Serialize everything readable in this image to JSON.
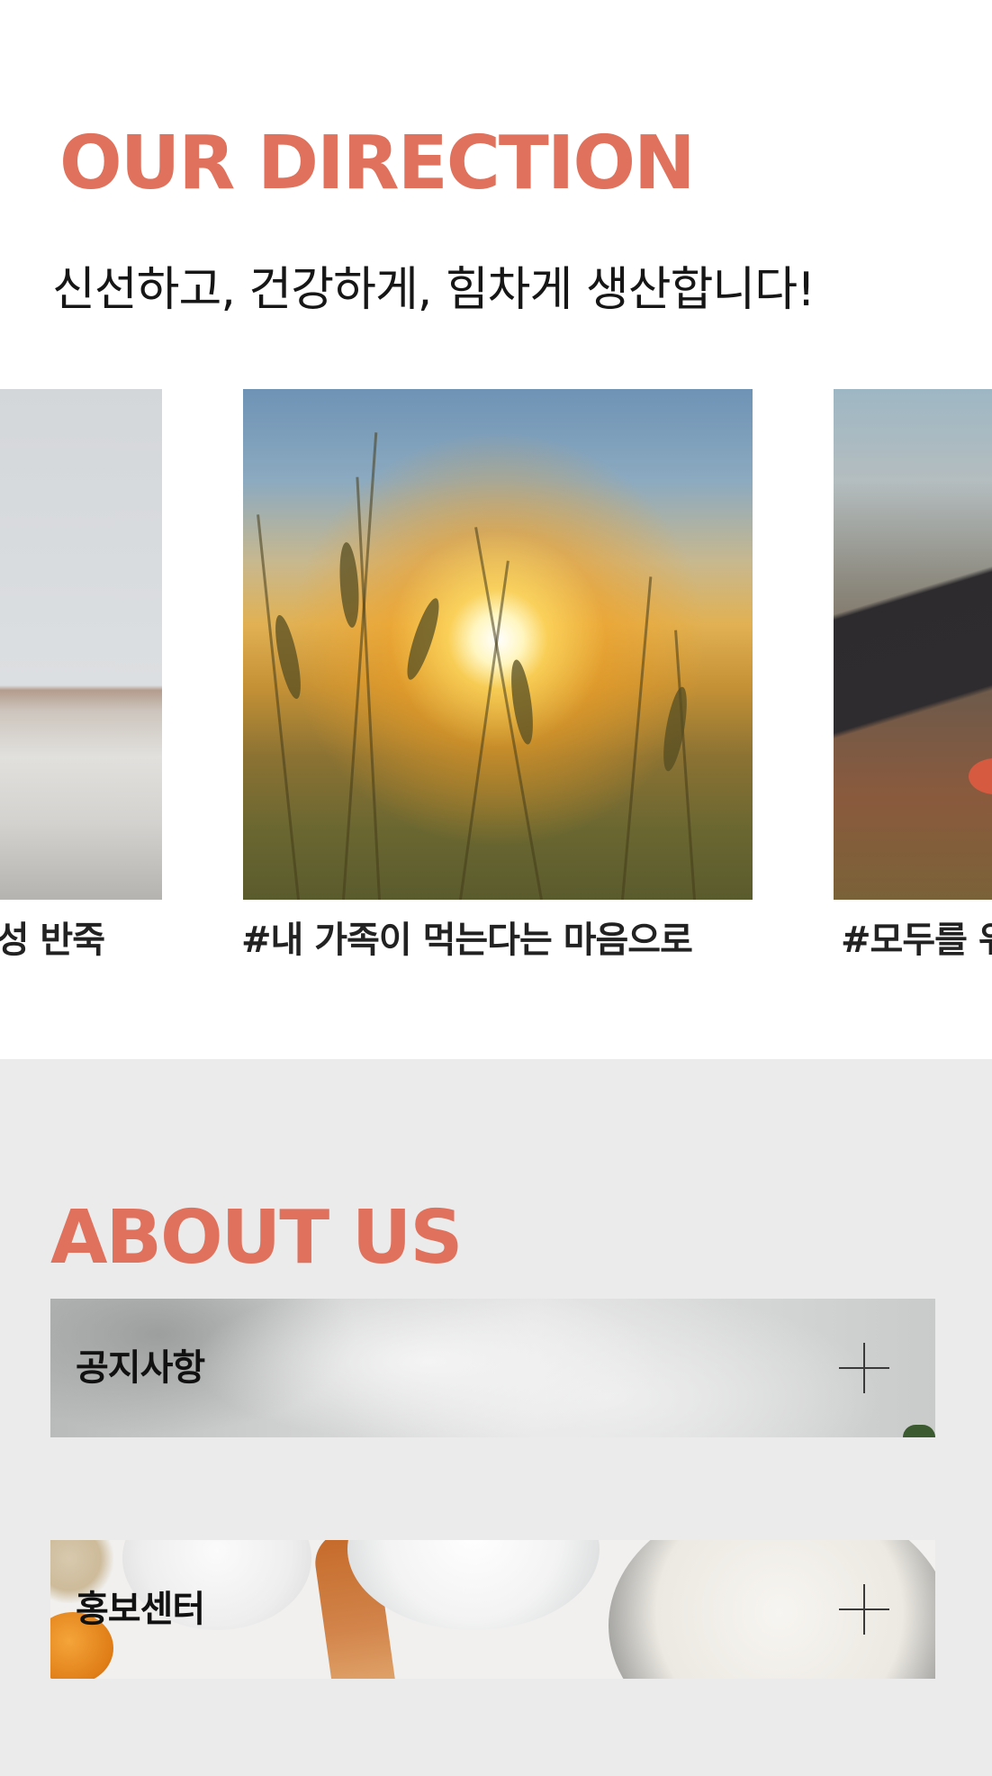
{
  "direction": {
    "title": "OUR DIRECTION",
    "subtitle": "신선하고, 건강하게, 힘차게 생산합니다!",
    "slides": [
      {
        "caption": "성 반죽",
        "image": "flour-on-table"
      },
      {
        "caption": "#내 가족이 먹는다는 마음으로",
        "image": "wheat-field-sunset"
      },
      {
        "caption": "#모두를 위",
        "image": "arm-in-field"
      }
    ]
  },
  "about": {
    "title": "ABOUT US",
    "banners": [
      {
        "label": "공지사항",
        "icon": "plus-icon"
      },
      {
        "label": "홍보센터",
        "icon": "plus-icon"
      }
    ]
  },
  "colors": {
    "accent": "#e0715c",
    "about_bg": "#ebebeb"
  }
}
